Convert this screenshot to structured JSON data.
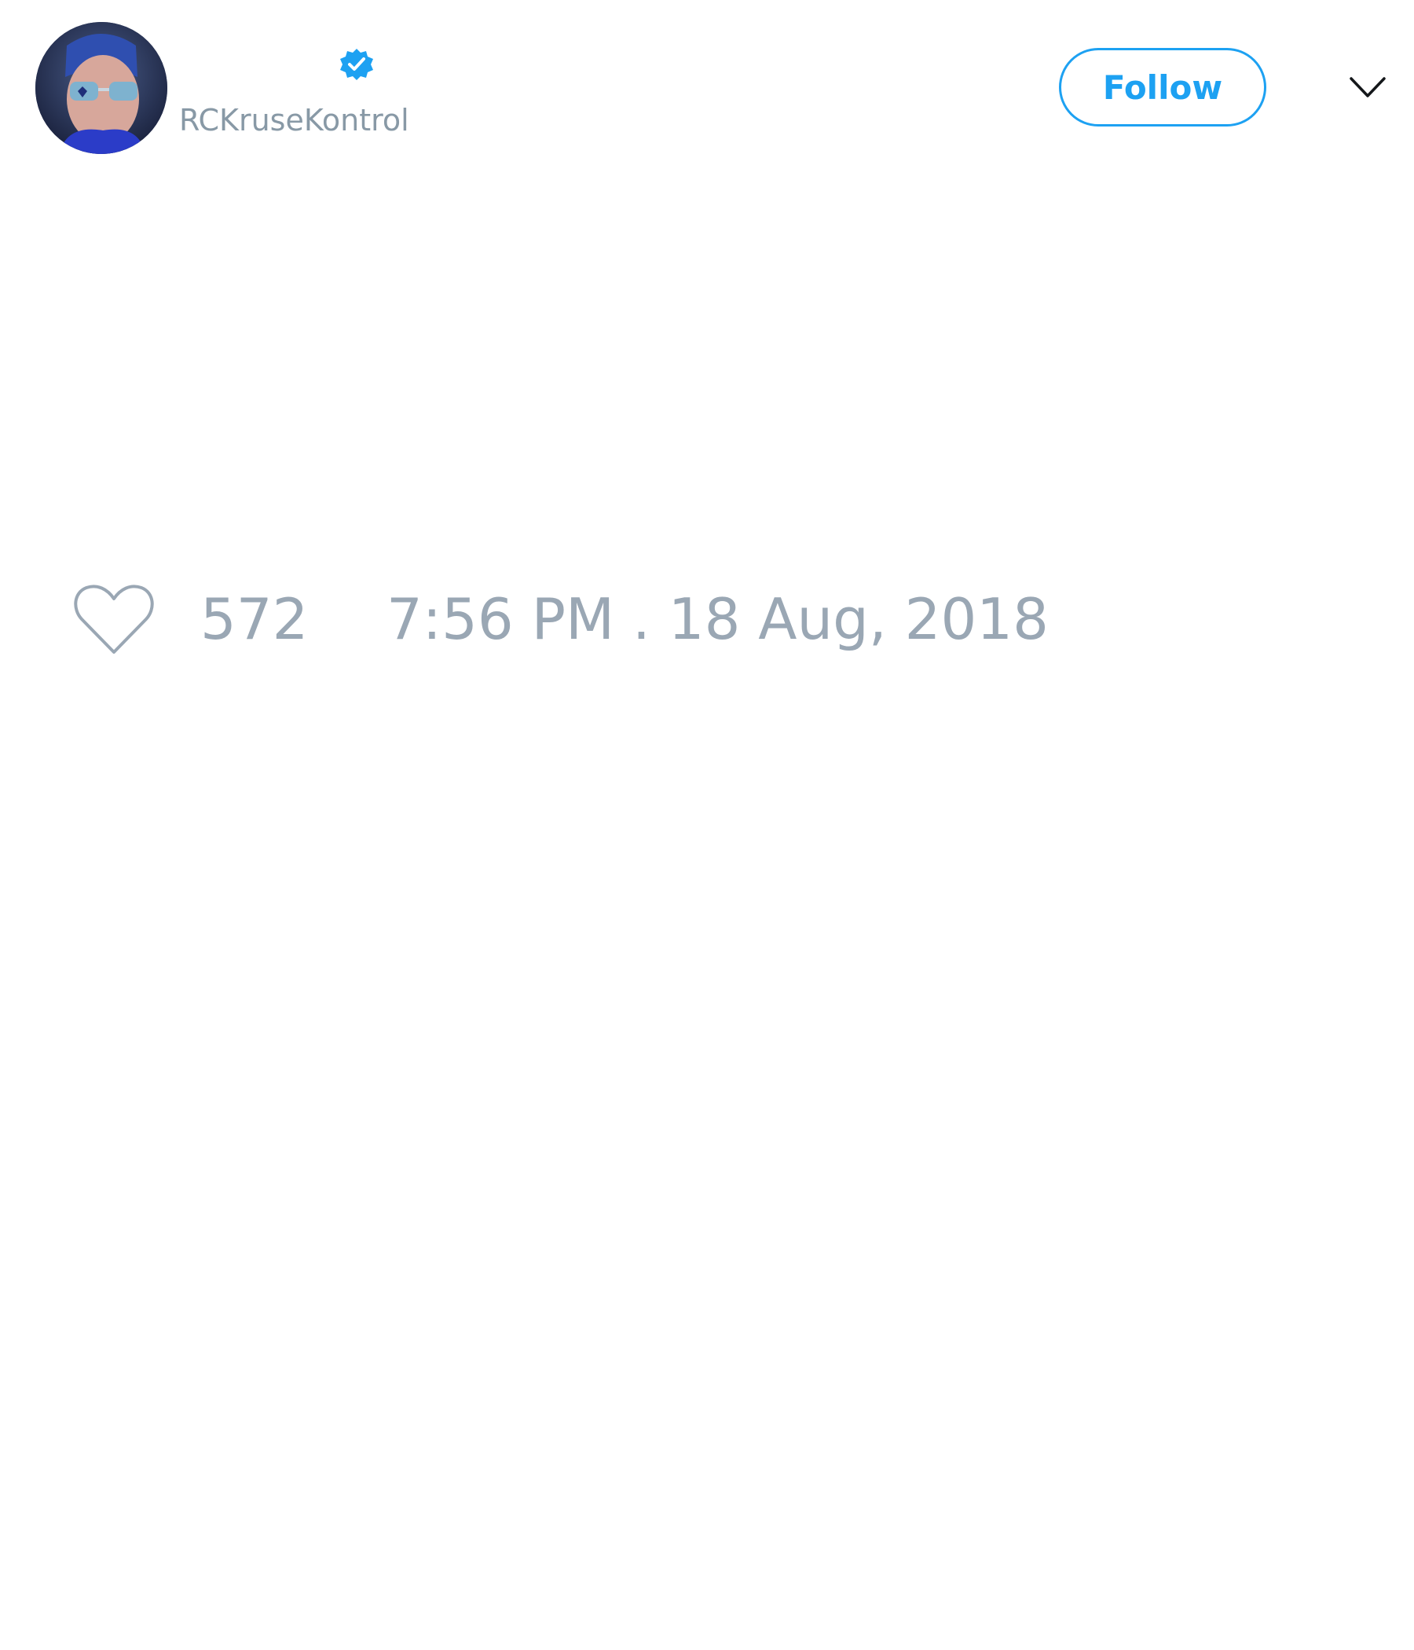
{
  "tweet": {
    "author": {
      "handle": "RCKruseKontrol",
      "verified": true,
      "avatar_icon": "profile-photo"
    },
    "follow_label": "Follow",
    "menu_icon": "chevron-down-icon",
    "like_icon": "heart-outline-icon",
    "likes": "572",
    "timestamp": "7:56 PM . 18 Aug, 2018"
  },
  "colors": {
    "accent": "#1da1f2",
    "muted_text": "#8899a6",
    "background": "#ffffff"
  }
}
